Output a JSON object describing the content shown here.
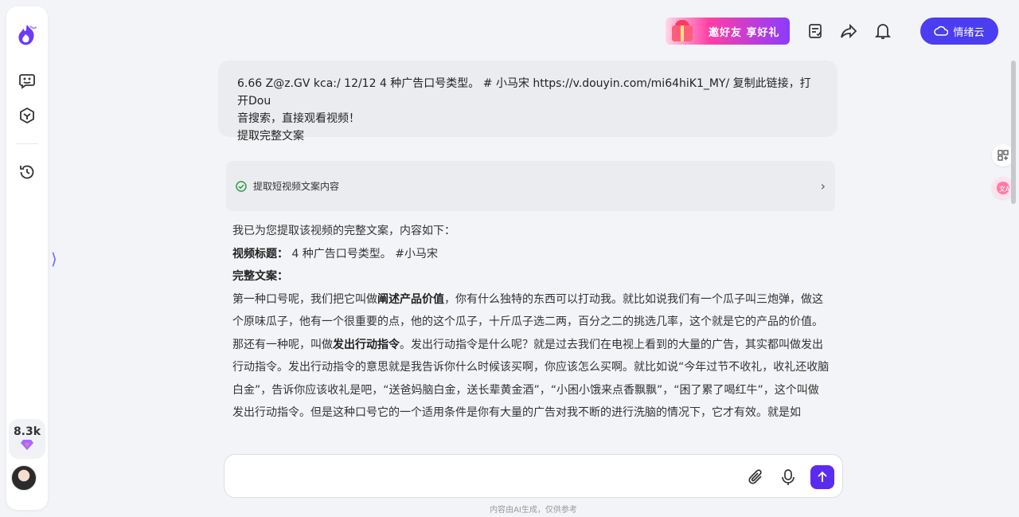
{
  "sidebar": {
    "logo": "flame-logo",
    "stats_count": "8.3k"
  },
  "header": {
    "promo_text": "邀好友 享好礼",
    "cloud_label": "情绪云"
  },
  "conversation": {
    "user_lines": [
      "6.66 Z@z.GV kca:/ 12/12 4 种广告口号类型。 # 小马宋  https://v.douyin.com/mi64hiK1_MY/ 复制此链接，打开Dou",
      "音搜索，直接观看视频！",
      "提取完整文案"
    ],
    "tool_card_label": "提取短视频文案内容",
    "answer": {
      "intro": "我已为您提取该视频的完整文案，内容如下：",
      "title_label": "视频标题：",
      "title_value": " 4 种广告口号类型。 #小马宋",
      "full_label": "完整文案：",
      "p1_a": "第一种口号呢，我们把它叫做",
      "p1_bold": "阐述产品价值",
      "p1_b": "，你有什么独特的东西可以打动我。就比如说我们有一个瓜子叫三炮弹，做这个原味瓜子，他有一个很重要的点，他的这个瓜子，十斤瓜子选二两，百分之二的挑选几率，这个就是它的产品的价值。",
      "p2_a": "那还有一种呢，叫做",
      "p2_bold": "发出行动指令",
      "p2_b": "。发出行动指令是什么呢？就是过去我们在电视上看到的大量的广告，其实都叫做发出行动指令。发出行动指令的意思就是我告诉你什么时候该买啊，你应该怎么买啊。就比如说“今年过节不收礼，收礼还收脑白金”，告诉你应该收礼是吧，“送爸妈脑白金，送长辈黄金酒”，“小困小饿来点香飘飘”，“困了累了喝红牛”，这个叫做发出行动指令。但是这种口号它的一个适用条件是你有大量的广告对我不断的进行洗脑的情况下，它才有效。就是如"
    }
  },
  "composer": {
    "placeholder": ""
  },
  "footer": {
    "disclaimer": "内容由AI生成，仅供参考"
  }
}
